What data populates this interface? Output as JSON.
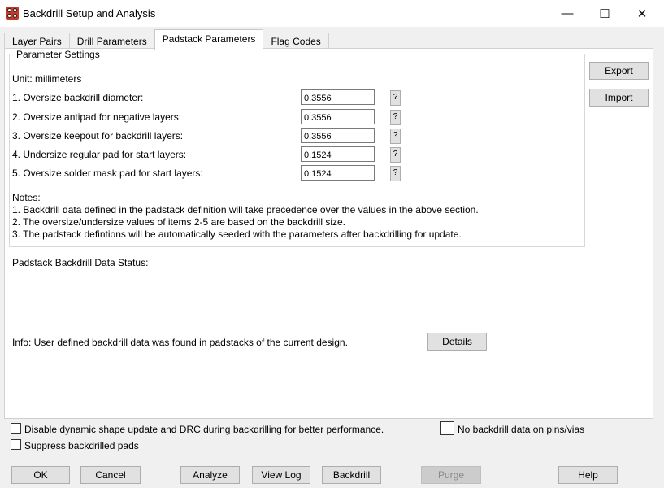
{
  "window": {
    "title": "Backdrill Setup and Analysis",
    "minimize": "—",
    "maximize": "☐",
    "close": "✕"
  },
  "tabs": [
    {
      "label": "Layer Pairs"
    },
    {
      "label": "Drill Parameters"
    },
    {
      "label": "Padstack Parameters",
      "active": true
    },
    {
      "label": "Flag Codes"
    }
  ],
  "parameters": {
    "group_title": "Parameter Settings",
    "unit": "Unit: millimeters",
    "rows": [
      {
        "label": "1. Oversize backdrill diameter:",
        "value": "0.3556",
        "help": "?"
      },
      {
        "label": "2. Oversize antipad for negative layers:",
        "value": "0.3556",
        "help": "?"
      },
      {
        "label": "3. Oversize keepout for backdrill layers:",
        "value": "0.3556",
        "help": "?"
      },
      {
        "label": "4. Undersize regular pad for start layers:",
        "value": "0.1524",
        "help": "?"
      },
      {
        "label": "5. Oversize solder mask pad for start layers:",
        "value": "0.1524",
        "help": "?"
      }
    ],
    "notes_title": "Notes:",
    "notes": [
      "1. Backdrill data defined in the padstack definition will take precedence over the values in the above section.",
      "2. The oversize/undersize values of items 2-5 are based on the backdrill size.",
      "3. The padstack defintions will be automatically seeded with the parameters after backdrilling for update."
    ]
  },
  "status": {
    "title": "Padstack Backdrill Data Status:",
    "info": "Info: User defined backdrill data was found in padstacks of the current design.",
    "details_button": "Details"
  },
  "side_buttons": {
    "export": "Export",
    "import": "Import"
  },
  "options": {
    "disable_dynamic": {
      "label": "Disable dynamic shape update and DRC during backdrilling for better performance.",
      "checked": false
    },
    "suppress_pads": {
      "label": "Suppress backdrilled pads",
      "checked": false
    },
    "no_backdrill": {
      "label": "No backdrill data on pins/vias",
      "checked": false
    }
  },
  "bottom_buttons": {
    "ok": "OK",
    "cancel": "Cancel",
    "analyze": "Analyze",
    "view_log": "View Log",
    "backdrill": "Backdrill",
    "purge": "Purge",
    "help": "Help"
  }
}
